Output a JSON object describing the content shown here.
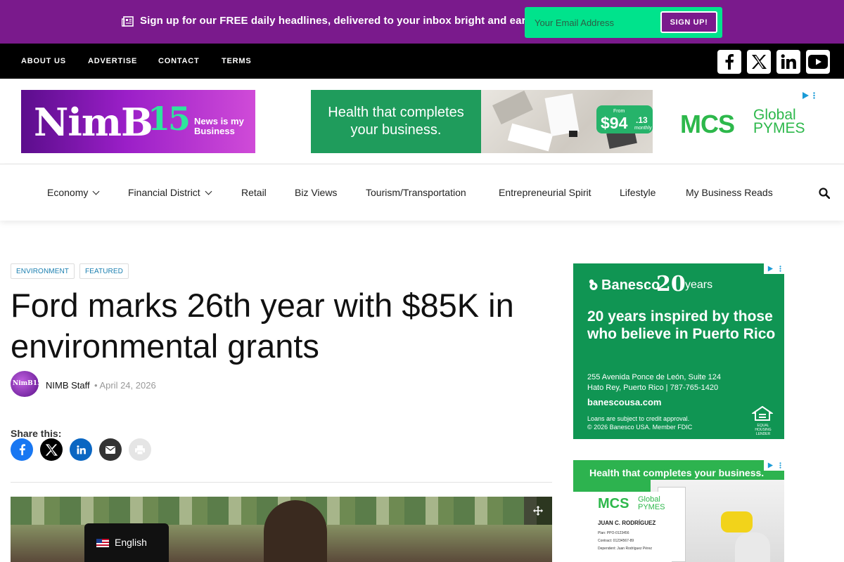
{
  "topbar": {
    "message": "Sign up for our FREE daily headlines, delivered to your inbox bright and early!",
    "email_placeholder": "Your Email Address",
    "signup_label": "SIGN UP!"
  },
  "navbar": {
    "links": [
      "ABOUT US",
      "ADVERTISE",
      "CONTACT",
      "TERMS"
    ],
    "social_icons": [
      "facebook-icon",
      "x-icon",
      "linkedin-icon",
      "youtube-icon"
    ]
  },
  "logo": {
    "name": "NimB",
    "number": "15",
    "tagline_1": "News is my",
    "tagline_2": "Business"
  },
  "top_ad": {
    "headline_1": "Health that completes",
    "headline_2": "your business.",
    "price_from": "From",
    "price_main": "$94",
    "price_cents": ".13",
    "price_period": "monthly",
    "brand": "MCS",
    "brand_global": "Global",
    "brand_pymes": "PYMES"
  },
  "mainnav": {
    "items": [
      "Economy",
      "Financial District",
      "Retail",
      "Biz Views",
      "Tourism/Transportation",
      "Entrepreneurial Spirit",
      "Lifestyle",
      "My Business Reads"
    ]
  },
  "article": {
    "categories": [
      "ENVIRONMENT",
      "FEATURED"
    ],
    "title": "Ford marks 26th year with $85K in environmental grants",
    "author": "NIMB Staff",
    "date": "April 24, 2026",
    "share_label": "Share this:",
    "avatar_text": "NimB15"
  },
  "language": {
    "label": "English"
  },
  "ad1": {
    "brand": "Banesco",
    "years_num": "20",
    "years_word": "years",
    "headline": "20 years inspired by those who believe in Puerto Rico",
    "address_1": "255 Avenida Ponce de León, Suite 124",
    "address_2": "Hato Rey, Puerto Rico  |  787-765-1420",
    "url": "banescousa.com",
    "fine_1": "Loans are subject to credit approval.",
    "fine_2": "© 2026 Banesco USA. Member FDIC",
    "lender": "EQUAL HOUSING LENDER"
  },
  "ad2": {
    "headline": "Health that completes your business.",
    "brand": "MCS",
    "brand_global": "Global",
    "brand_pymes": "PYMES",
    "card_name": "JUAN C. RODRÍGUEZ",
    "card_plan": "Plan: PPO-0123456",
    "card_contract": "Contract: 01234567-89",
    "card_dependent": "Dependent: Juan Rodríguez Pérez"
  },
  "colors": {
    "purple": "#7a1a8c",
    "green": "#00e38c",
    "banesco_green": "#109553"
  }
}
